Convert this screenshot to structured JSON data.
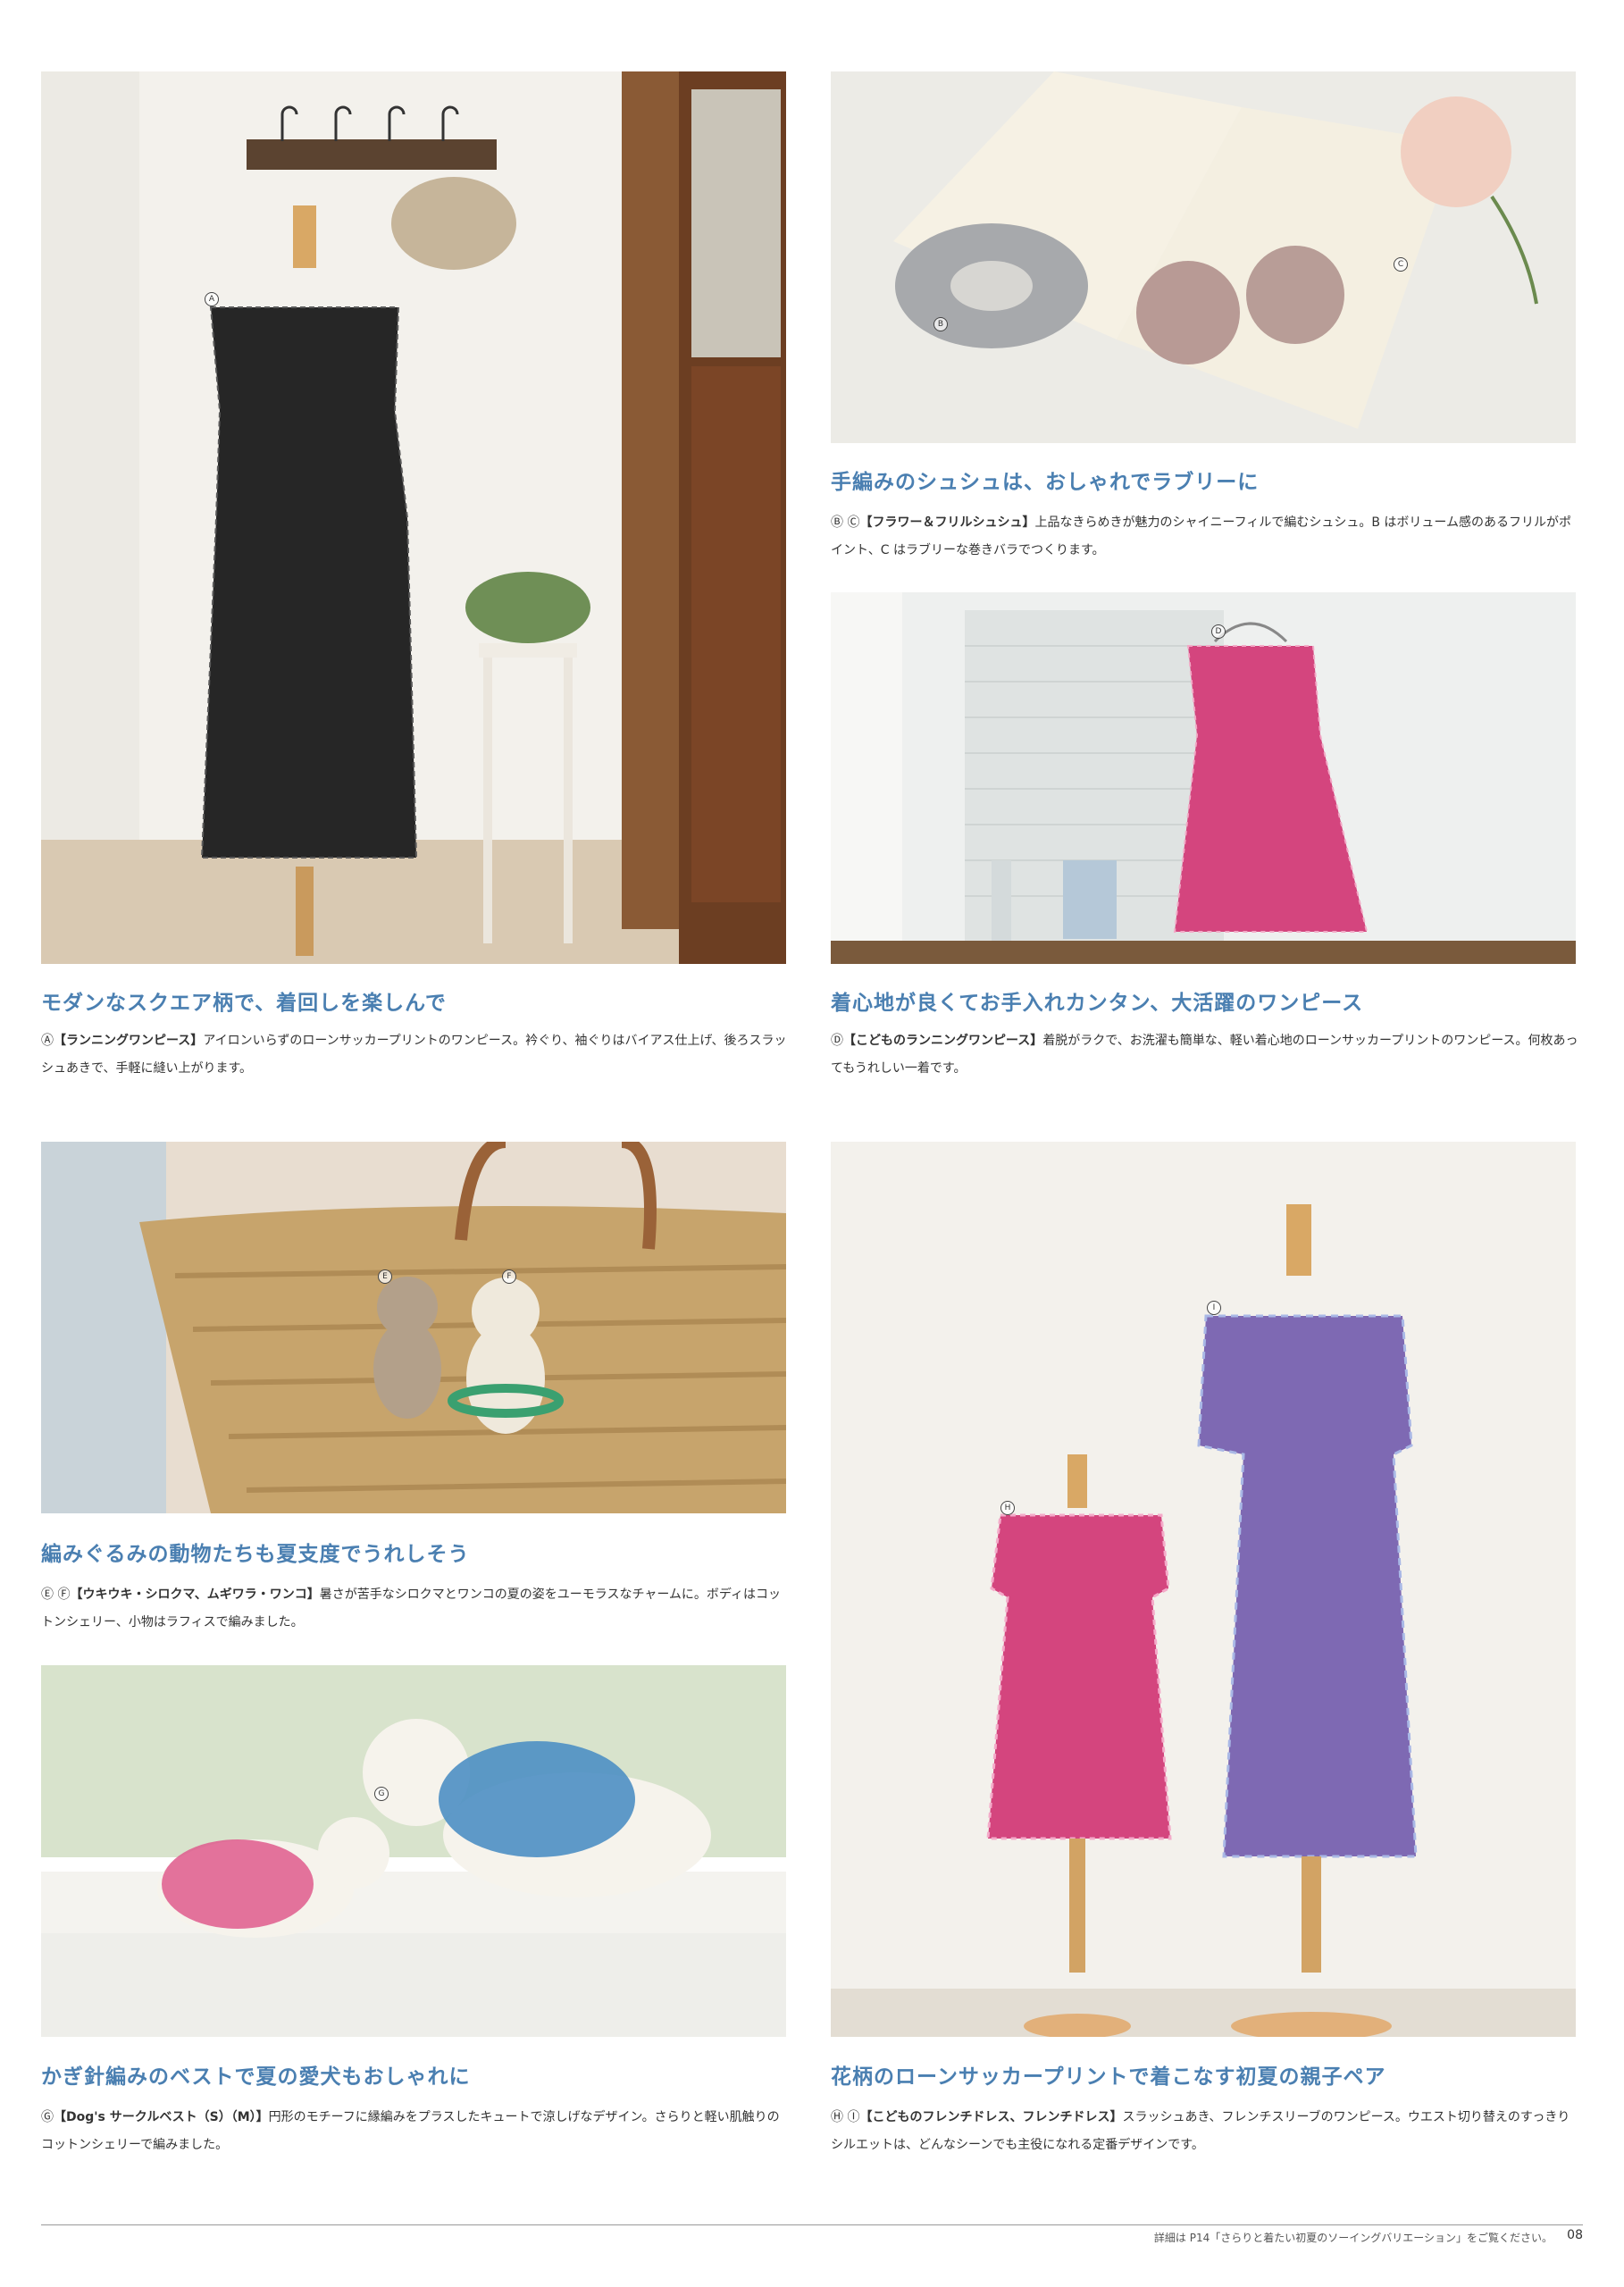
{
  "sections": {
    "dress": {
      "marker": "A",
      "heading": "モダンなスクエア柄で、着回しを楽しんで",
      "caption_code": "Ⓐ",
      "caption_name": "【ランニングワンピース】",
      "caption_text": "アイロンいらずのローンサッカープリントのワンピース。衿ぐり、袖ぐりはバイアス仕上げ、後ろスラッシュあきで、手軽に縫い上がります。"
    },
    "scrunchie": {
      "marker_b": "B",
      "marker_c": "C",
      "heading": "手編みのシュシュは、おしゃれでラブリーに",
      "caption_code": "Ⓑ Ⓒ",
      "caption_name": "【フラワー＆フリルシュシュ】",
      "caption_text": "上品なきらめきが魅力のシャイニーフィルで編むシュシュ。B はボリューム感のあるフリルがポイント、C はラブリーな巻きバラでつくります。"
    },
    "kids_dress": {
      "marker": "D",
      "heading": "着心地が良くてお手入れカンタン、大活躍のワンピース",
      "caption_code": "Ⓓ",
      "caption_name": "【こどものランニングワンピース】",
      "caption_text": "着脱がラクで、お洗濯も簡単な、軽い着心地のローンサッカープリントのワンピース。何枚あってもうれしい一着です。"
    },
    "amigurumi": {
      "marker_e": "E",
      "marker_f": "F",
      "heading": "編みぐるみの動物たちも夏支度でうれしそう",
      "caption_code": "Ⓔ Ⓕ",
      "caption_name": "【ウキウキ・シロクマ、ムギワラ・ワンコ】",
      "caption_text": "暑さが苦手なシロクマとワンコの夏の姿をユーモラスなチャームに。ボディはコットンシェリー、小物はラフィスで編みました。"
    },
    "dog_vest": {
      "marker": "G",
      "heading": "かぎ針編みのベストで夏の愛犬もおしゃれに",
      "caption_code": "Ⓖ",
      "caption_name": "【Dog's サークルベスト（S）（M）】",
      "caption_text": "円形のモチーフに縁編みをプラスしたキュートで涼しげなデザイン。さらりと軽い肌触りのコットンシェリーで編みました。"
    },
    "pair": {
      "marker_h": "H",
      "marker_i": "I",
      "heading": "花柄のローンサッカープリントで着こなす初夏の親子ペア",
      "caption_code": "Ⓗ Ⓘ",
      "caption_name": "【こどものフレンチドレス、フレンチドレス】",
      "caption_text": "スラッシュあき、フレンチスリーブのワンピース。ウエスト切り替えのすっきりシルエットは、どんなシーンでも主役になれる定番デザインです。"
    }
  },
  "footer": {
    "note": "詳細は P14「さらりと着たい初夏のソーイングバリエーション」をご覧ください。",
    "page_number": "08"
  },
  "colors": {
    "heading": "#4a7fb1",
    "dress_print": "#2a2a2a",
    "pink_print": "#d4457e",
    "purple_print": "#7e69b3",
    "wood": "#7a4a2a"
  }
}
